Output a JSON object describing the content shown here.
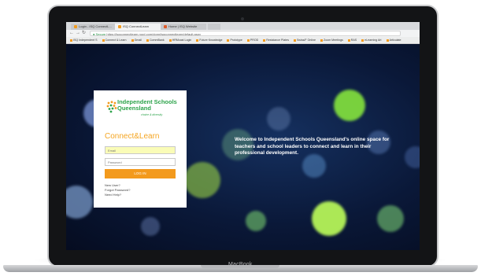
{
  "browser": {
    "tabs": [
      {
        "label": "Login - ISQ ConnectL...",
        "favicon_color": "#f39c1f",
        "active": false
      },
      {
        "label": "ISQ ConnectLearn",
        "favicon_color": "#f39c1f",
        "active": true
      },
      {
        "label": "Home | ISQ Website",
        "favicon_color": "#e05c2a",
        "active": false
      }
    ],
    "nav_icons": [
      "back-arrow-icon",
      "forward-arrow-icon",
      "reload-icon"
    ],
    "secure_label": "Secure",
    "url": "https://isqconnectlearn.rood.com/donn/isqconnectlearn/default.aspx",
    "bookmarks": [
      "ISQ Independent S",
      "Connect & Learn",
      "Gmail",
      "CommBank",
      "HRMcast Login",
      "Future Knowledge",
      "Prototype",
      "PROD",
      "Resistance Plates",
      "Swiss/F Online",
      "Zoom Meetings",
      "RAS",
      "eLearning Art",
      "Articulate"
    ]
  },
  "login": {
    "logo_line1": "Independent Schools",
    "logo_line2": "Queensland",
    "logo_tagline": "choice & diversity",
    "app_title": "Connect&Learn",
    "email_placeholder": "Email",
    "password_placeholder": "Password",
    "login_button": "LOG IN",
    "links": [
      "New User?",
      "Forgot Password?",
      "Need Help?"
    ]
  },
  "welcome_text": "Welcome to Independent Schools Queensland's online space for teachers and school leaders to connect and learn in their professional development.",
  "device_label": "MacBook",
  "colors": {
    "accent": "#f39a1d",
    "logo_green": "#2ca34a",
    "background": "#0a1838"
  }
}
